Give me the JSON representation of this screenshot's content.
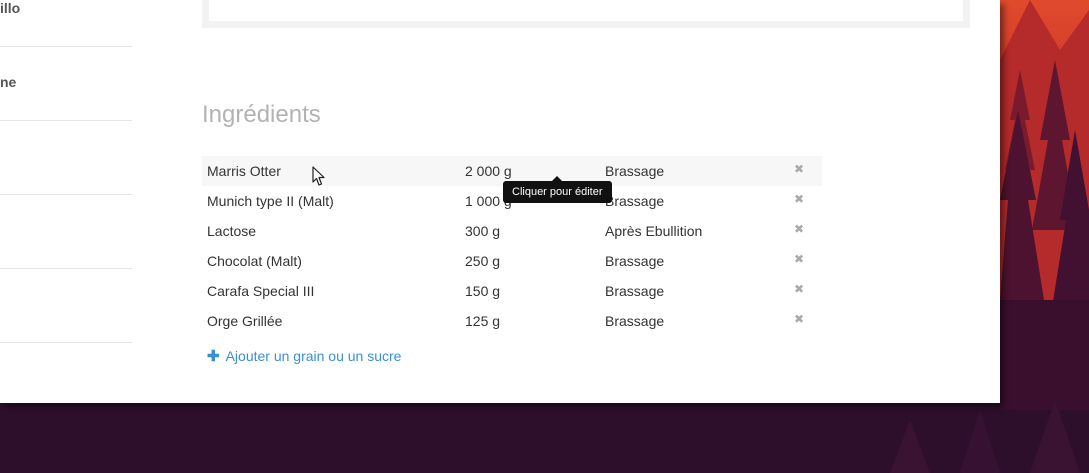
{
  "sidebar": {
    "items": [
      {
        "label": "illo"
      },
      {
        "label": "ne"
      },
      {
        "label": ""
      },
      {
        "label": ""
      },
      {
        "label": ""
      }
    ]
  },
  "section": {
    "title": "Ingrédients"
  },
  "ingredients": [
    {
      "name": "Marris Otter",
      "quantity": "2 000 g",
      "stage": "Brassage",
      "remove": "✖"
    },
    {
      "name": "Munich type II (Malt)",
      "quantity": "1 000 g",
      "stage": "Brassage",
      "remove": "✖"
    },
    {
      "name": "Lactose",
      "quantity": "300 g",
      "stage": "Après Ebullition",
      "remove": "✖"
    },
    {
      "name": "Chocolat (Malt)",
      "quantity": "250 g",
      "stage": "Brassage",
      "remove": "✖"
    },
    {
      "name": "Carafa Special III",
      "quantity": "150 g",
      "stage": "Brassage",
      "remove": "✖"
    },
    {
      "name": "Orge Grillée",
      "quantity": "125 g",
      "stage": "Brassage",
      "remove": "✖"
    }
  ],
  "add_link": {
    "icon": "plus-icon",
    "label": "Ajouter un grain ou un sucre"
  },
  "tooltip": {
    "text": "Cliquer pour éditer"
  },
  "colors": {
    "link": "#3a8fd4",
    "title": "#b3b3b3",
    "desktop": "#2e0f2b"
  }
}
